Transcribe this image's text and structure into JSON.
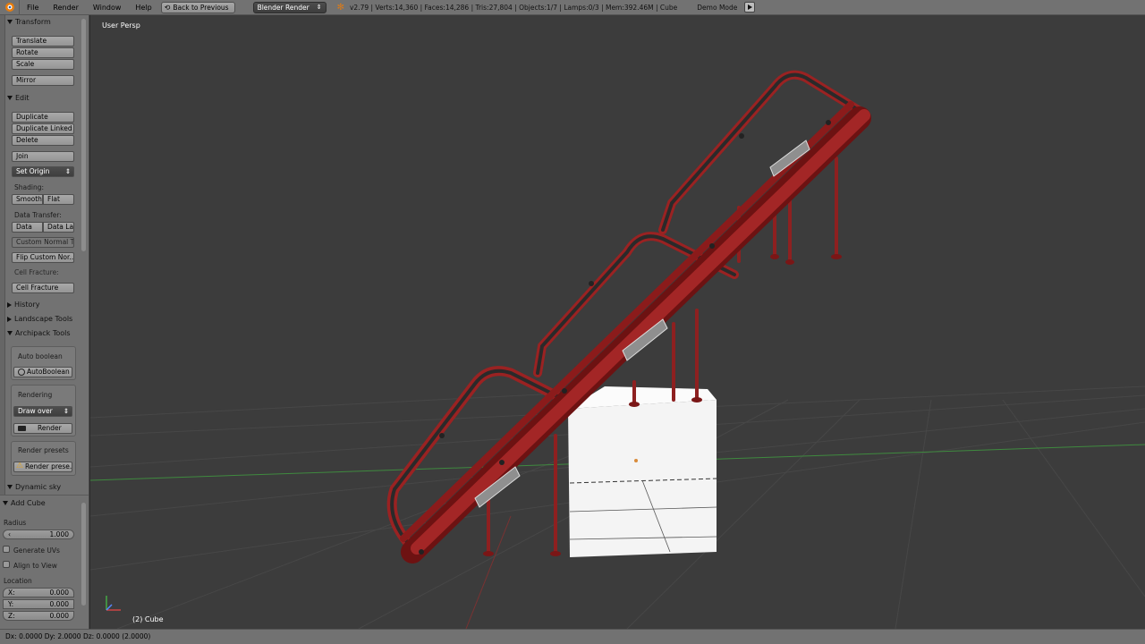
{
  "topbar": {
    "menus": [
      "File",
      "Render",
      "Window",
      "Help"
    ],
    "back_button": "Back to Previous",
    "engine": "Blender Render",
    "stats": "v2.79 | Verts:14,360 | Faces:14,286 | Tris:27,804 | Objects:1/7 | Lamps:0/3 | Mem:392.46M | Cube",
    "demo_mode": "Demo Mode"
  },
  "toolshelf": {
    "transform": {
      "title": "Transform",
      "translate": "Translate",
      "rotate": "Rotate",
      "scale": "Scale",
      "mirror": "Mirror"
    },
    "edit": {
      "title": "Edit",
      "duplicate": "Duplicate",
      "duplicate_linked": "Duplicate Linked",
      "delete": "Delete",
      "join": "Join",
      "set_origin": "Set Origin"
    },
    "shading": {
      "label": "Shading:",
      "smooth": "Smooth",
      "flat": "Flat"
    },
    "data_transfer": {
      "label": "Data Transfer:",
      "data": "Data",
      "data_layout": "Data La"
    },
    "custom_normal": "Custom Normal T...",
    "flip_custom": "Flip Custom Nor...",
    "cell_fracture_label": "Cell Fracture:",
    "cell_fracture": "Cell Fracture",
    "history": "History",
    "landscape": "Landscape Tools",
    "archipack": {
      "title": "Archipack Tools",
      "auto_boolean_label": "Auto boolean",
      "auto_boolean": "AutoBoolean",
      "rendering": "Rendering",
      "draw_over": "Draw over",
      "render": "Render",
      "render_presets_label": "Render presets",
      "render_presets": "Render prese..."
    },
    "dynamic_sky": "Dynamic sky"
  },
  "operator": {
    "title": "Add Cube",
    "radius_label": "Radius",
    "radius": "1.000",
    "generate_uvs": "Generate UVs",
    "align_to_view": "Align to View",
    "location_label": "Location",
    "x_label": "X:",
    "x": "0.000",
    "y_label": "Y:",
    "y": "0.000",
    "z_label": "Z:",
    "z": "0.000"
  },
  "viewport": {
    "view_name": "User Persp",
    "object_label": "(2) Cube"
  },
  "statusbar": {
    "text": "Dx: 0.0000  Dy: 2.0000  Dz: 0.0000 (2.0000)"
  },
  "colors": {
    "header": "#727272",
    "viewport_bg": "#3c3c3c",
    "grid": "#4a4a4a",
    "x_axis": "#7a2f2f",
    "y_axis": "#3c8a3c",
    "coaster_red": "#8a1b1b",
    "cube": "#f5f5f5"
  },
  "icons": [
    "blender-logo-icon",
    "back-icon",
    "render-icon",
    "play-icon",
    "sphere-icon",
    "camera-icon",
    "warning-icon",
    "axis-gizmo-icon"
  ]
}
